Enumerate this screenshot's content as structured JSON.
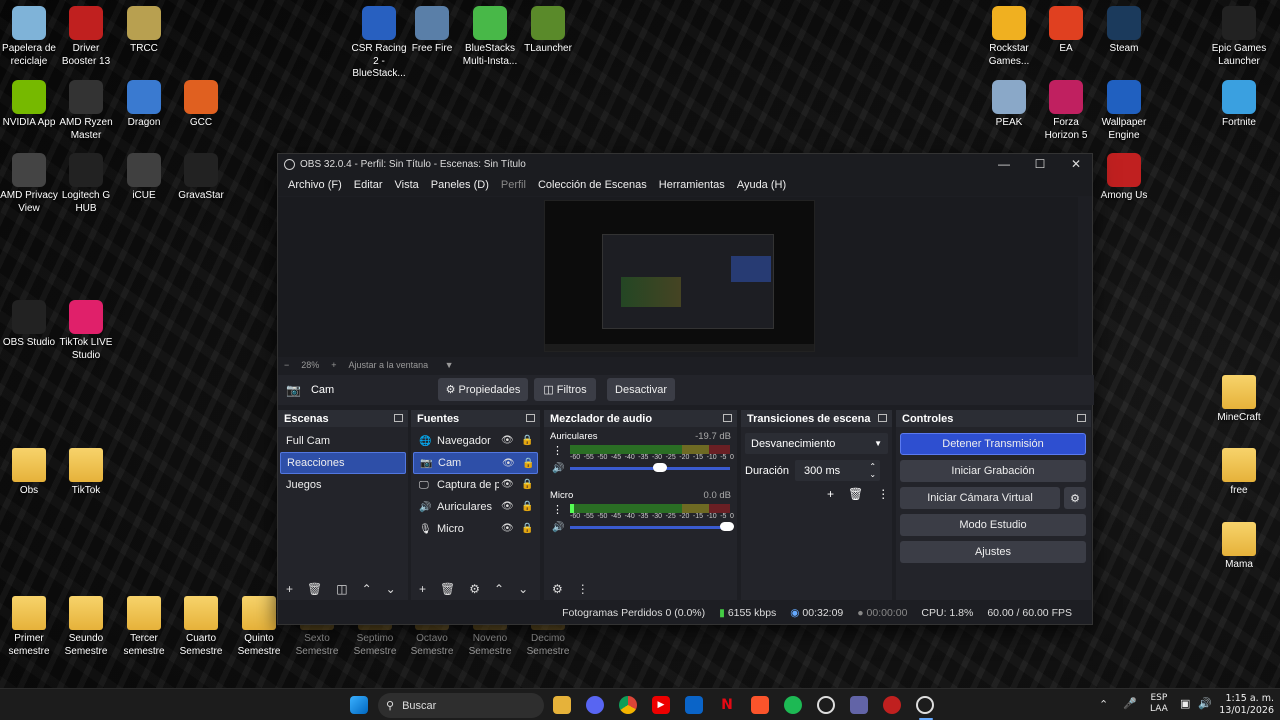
{
  "desktop_icons": [
    {
      "label": "Papelera de reciclaje",
      "icon": "recycle-bin-icon",
      "color": "#7fb3d8"
    },
    {
      "label": "Driver Booster 13",
      "icon": "driver-booster-icon",
      "color": "#c0201f"
    },
    {
      "label": "TRCC",
      "icon": "trcc-icon",
      "color": "#b8a050"
    },
    {
      "label": "CSR Racing 2 - BlueStack...",
      "icon": "csr-racing-icon",
      "color": "#2860c0"
    },
    {
      "label": "Free Fire",
      "icon": "free-fire-icon",
      "color": "#5a7fa8"
    },
    {
      "label": "BlueStacks Multi-Insta...",
      "icon": "bluestacks-icon",
      "color": "#48b848"
    },
    {
      "label": "TLauncher",
      "icon": "tlauncher-icon",
      "color": "#5a8a2a"
    },
    {
      "label": "Rockstar Games...",
      "icon": "rockstar-icon",
      "color": "#f0b020"
    },
    {
      "label": "EA",
      "icon": "ea-icon",
      "color": "#e04020"
    },
    {
      "label": "Steam",
      "icon": "steam-icon",
      "color": "#1b3a5c"
    },
    {
      "label": "Epic Games Launcher",
      "icon": "epic-games-icon",
      "color": "#222222"
    },
    {
      "label": "NVIDIA App",
      "icon": "nvidia-icon",
      "color": "#76b900"
    },
    {
      "label": "AMD Ryzen Master",
      "icon": "ryzen-icon",
      "color": "#333333"
    },
    {
      "label": "Dragon",
      "icon": "dragon-icon",
      "color": "#3a7ad0"
    },
    {
      "label": "GCC",
      "icon": "gcc-icon",
      "color": "#e06020"
    },
    {
      "label": "PEAK",
      "icon": "peak-icon",
      "color": "#8aa8c8"
    },
    {
      "label": "Forza Horizon 5",
      "icon": "forza-icon",
      "color": "#c02060"
    },
    {
      "label": "Wallpaper Engine",
      "icon": "wallpaper-engine-icon",
      "color": "#2060c0"
    },
    {
      "label": "Fortnite",
      "icon": "fortnite-icon",
      "color": "#3aa0e0"
    },
    {
      "label": "AMD Privacy View",
      "icon": "amd-privacy-icon",
      "color": "#444444"
    },
    {
      "label": "Logitech G HUB",
      "icon": "logitech-icon",
      "color": "#222222"
    },
    {
      "label": "iCUE",
      "icon": "icue-icon",
      "color": "#404040"
    },
    {
      "label": "GravaStar",
      "icon": "gravastar-icon",
      "color": "#222222"
    },
    {
      "label": "Among Us",
      "icon": "among-us-icon",
      "color": "#c02020"
    },
    {
      "label": "OBS Studio",
      "icon": "obs-icon",
      "color": "#222222"
    },
    {
      "label": "TikTok LIVE Studio",
      "icon": "tiktok-icon",
      "color": "#e0206a"
    },
    {
      "label": "MineCraft",
      "icon": "folder-icon",
      "color": "#e6b23a"
    },
    {
      "label": "Obs",
      "icon": "folder-icon",
      "color": "#e6b23a"
    },
    {
      "label": "TikTok",
      "icon": "folder-icon",
      "color": "#e6b23a"
    },
    {
      "label": "free",
      "icon": "folder-icon",
      "color": "#e6b23a"
    },
    {
      "label": "Mama",
      "icon": "folder-icon",
      "color": "#e6b23a"
    },
    {
      "label": "Primer semestre",
      "icon": "folder-icon",
      "color": "#e6b23a"
    },
    {
      "label": "Seundo Semestre",
      "icon": "folder-icon",
      "color": "#e6b23a"
    },
    {
      "label": "Tercer semestre",
      "icon": "folder-icon",
      "color": "#e6b23a"
    },
    {
      "label": "Cuarto Semestre",
      "icon": "folder-icon",
      "color": "#e6b23a"
    },
    {
      "label": "Quinto Semestre",
      "icon": "folder-icon",
      "color": "#e6b23a"
    },
    {
      "label": "Sexto Semestre",
      "icon": "folder-icon",
      "color": "#e6b23a"
    },
    {
      "label": "Septimo Semestre",
      "icon": "folder-icon",
      "color": "#e6b23a"
    },
    {
      "label": "Octavo Semestre",
      "icon": "folder-icon",
      "color": "#e6b23a"
    },
    {
      "label": "Noveno Semestre",
      "icon": "folder-icon",
      "color": "#e6b23a"
    },
    {
      "label": "Decimo Semestre",
      "icon": "folder-icon",
      "color": "#e6b23a"
    }
  ],
  "obs": {
    "title": "OBS 32.0.4 - Perfil: Sin Título - Escenas: Sin Título",
    "menu": [
      "Archivo (F)",
      "Editar",
      "Vista",
      "Paneles (D)",
      "Perfil",
      "Colección de Escenas",
      "Herramientas",
      "Ayuda (H)"
    ],
    "zoom": {
      "minus": "−",
      "value": "28%",
      "plus": "+",
      "fit": "Ajustar a la ventana"
    },
    "source_bar": {
      "name": "Cam",
      "properties": "Propiedades",
      "filters": "Filtros",
      "deactivate": "Desactivar"
    },
    "scenes": {
      "title": "Escenas",
      "items": [
        "Full Cam",
        "Reacciones",
        "Juegos"
      ],
      "selected": 1
    },
    "sources": {
      "title": "Fuentes",
      "items": [
        {
          "label": "Navegador",
          "icon": "globe-icon"
        },
        {
          "label": "Cam",
          "icon": "camera-icon"
        },
        {
          "label": "Captura de pa",
          "icon": "monitor-icon"
        },
        {
          "label": "Auriculares",
          "icon": "speaker-icon"
        },
        {
          "label": "Micro",
          "icon": "mic-icon"
        }
      ],
      "selected": 1
    },
    "mixer": {
      "title": "Mezclador de audio",
      "ticks": [
        "-60",
        "-55",
        "-50",
        "-45",
        "-40",
        "-35",
        "-30",
        "-25",
        "-20",
        "-15",
        "-10",
        "-5",
        "0"
      ],
      "channels": [
        {
          "name": "Auriculares",
          "db": "-19.7 dB",
          "level": 0.55
        },
        {
          "name": "Micro",
          "db": "0.0 dB",
          "level": 1.0
        }
      ]
    },
    "transitions": {
      "title": "Transiciones de escena",
      "selected": "Desvanecimiento",
      "duration_label": "Duración",
      "duration": "300 ms"
    },
    "controls": {
      "title": "Controles",
      "stream": "Detener Transmisión",
      "record": "Iniciar Grabación",
      "virtual_cam": "Iniciar Cámara Virtual",
      "studio": "Modo Estudio",
      "settings": "Ajustes",
      "accent": "#2e4fd0"
    },
    "status": {
      "dropped": "Fotogramas Perdidos 0 (0.0%)",
      "bitrate": "6155 kbps",
      "stream_time": "00:32:09",
      "rec_time": "00:00:00",
      "cpu": "CPU: 1.8%",
      "fps": "60.00 / 60.00 FPS"
    }
  },
  "taskbar": {
    "search": "Buscar",
    "lang": "ESP",
    "lang2": "LAA",
    "time": "1:15 a. m.",
    "date": "13/01/2026"
  }
}
